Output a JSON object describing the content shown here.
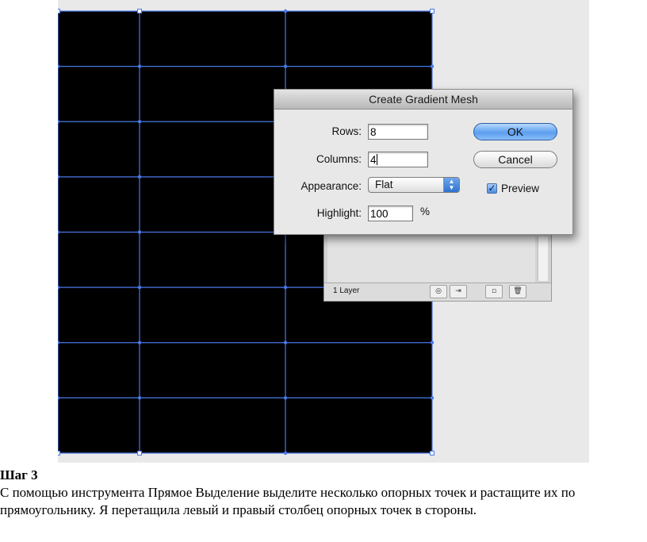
{
  "dialog": {
    "title": "Create Gradient Mesh",
    "rows_label": "Rows:",
    "rows_value": "8",
    "columns_label": "Columns:",
    "columns_value": "4",
    "appearance_label": "Appearance:",
    "appearance_value": "Flat",
    "highlight_label": "Highlight:",
    "highlight_value": "100",
    "highlight_unit": "%",
    "ok_label": "OK",
    "cancel_label": "Cancel",
    "preview_label": "Preview",
    "preview_checked": true
  },
  "layers_panel": {
    "layer_count": "1 Layer",
    "buttons": [
      "locate-object-icon",
      "make-clipping-mask-icon",
      "new-layer-icon",
      "trash-icon"
    ]
  },
  "artwork": {
    "fill_color": "#000000",
    "mesh_color": "#4a78e8"
  },
  "caption": {
    "step": "Шаг 3",
    "text": "С помощью инструмента Прямое Выделение выделите несколько опорных точек и растащите их по прямоугольнику. Я перетащила левый и правый столбец опорных точек в стороны."
  }
}
